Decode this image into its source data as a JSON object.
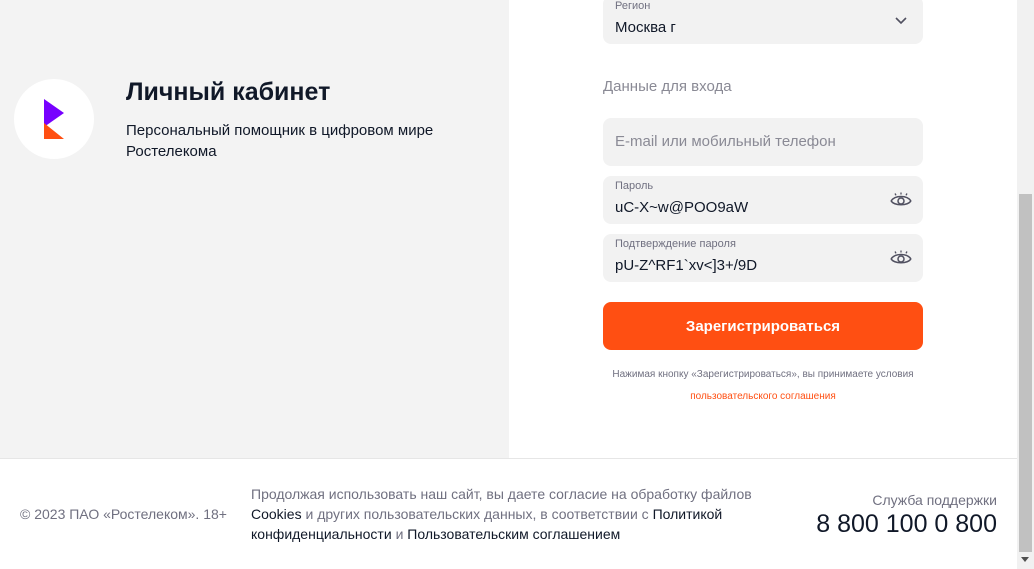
{
  "brand": {
    "title": "Личный кабинет",
    "subtitle": "Персональный помощник в цифровом мире Ростелекома",
    "logo_icon": "rostelecom-logo-icon",
    "colors": {
      "purple": "#7700ff",
      "orange": "#ff4f12"
    }
  },
  "form": {
    "region": {
      "label": "Регион",
      "value": "Москва г",
      "icon": "chevron-down-icon"
    },
    "section_label": "Данные для входа",
    "login": {
      "placeholder": "E-mail или мобильный телефон"
    },
    "password": {
      "label": "Пароль",
      "value": "uC-X~w@POO9aW",
      "icon": "eye-icon"
    },
    "password_confirm": {
      "label": "Подтверждение пароля",
      "value": "pU-Z^RF1`xv<]3+/9D",
      "icon": "eye-icon"
    },
    "submit_label": "Зарегистрироваться",
    "submit_color": "#ff4f12",
    "legal_prefix": "Нажимая кнопку «Зарегистрироваться», вы принимаете условия",
    "legal_link": "пользовательского соглашения"
  },
  "footer": {
    "copyright": "© 2023 ПАО «Ростелеком». 18+",
    "consent": {
      "part1": "Продолжая использовать наш сайт, вы даете согласие на обработку файлов",
      "cookies_link": "Cookies",
      "part2": "и других пользовательских данных, в соответствии с",
      "policy_link": "Политикой конфиденциальности",
      "part3": "и",
      "agreement_link": "Пользовательским соглашением"
    },
    "support_label": "Служба поддержки",
    "support_phone": "8 800 100 0 800"
  }
}
